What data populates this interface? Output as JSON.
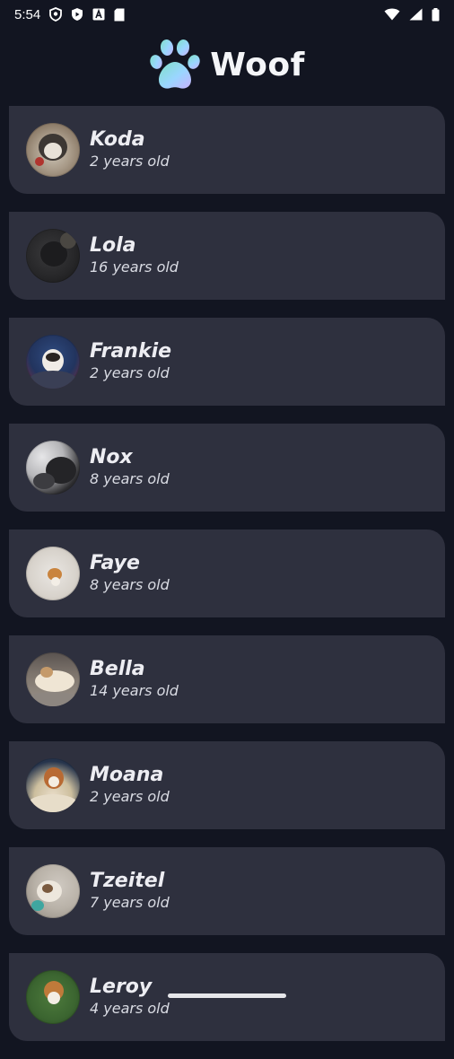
{
  "status_bar": {
    "time": "5:54",
    "icons_left": [
      "shield-icon",
      "play-protect-icon",
      "font-icon",
      "sd-card-icon"
    ],
    "icons_right": [
      "wifi-icon",
      "signal-icon",
      "battery-icon"
    ]
  },
  "app_bar": {
    "logo": "paw-icon",
    "title": "Woof",
    "logo_colors": [
      "#7fe0c7",
      "#9ad6ff",
      "#c8b3ff"
    ]
  },
  "dogs": [
    {
      "name": "Koda",
      "age": "2 years old"
    },
    {
      "name": "Lola",
      "age": "16 years old"
    },
    {
      "name": "Frankie",
      "age": "2 years old"
    },
    {
      "name": "Nox",
      "age": "8 years old"
    },
    {
      "name": "Faye",
      "age": "8 years old"
    },
    {
      "name": "Bella",
      "age": "14 years old"
    },
    {
      "name": "Moana",
      "age": "2 years old"
    },
    {
      "name": "Tzeitel",
      "age": "7 years old"
    },
    {
      "name": "Leroy",
      "age": "4 years old"
    }
  ],
  "colors": {
    "background": "#121521",
    "card": "#2e303e",
    "text": "#ededf2"
  }
}
